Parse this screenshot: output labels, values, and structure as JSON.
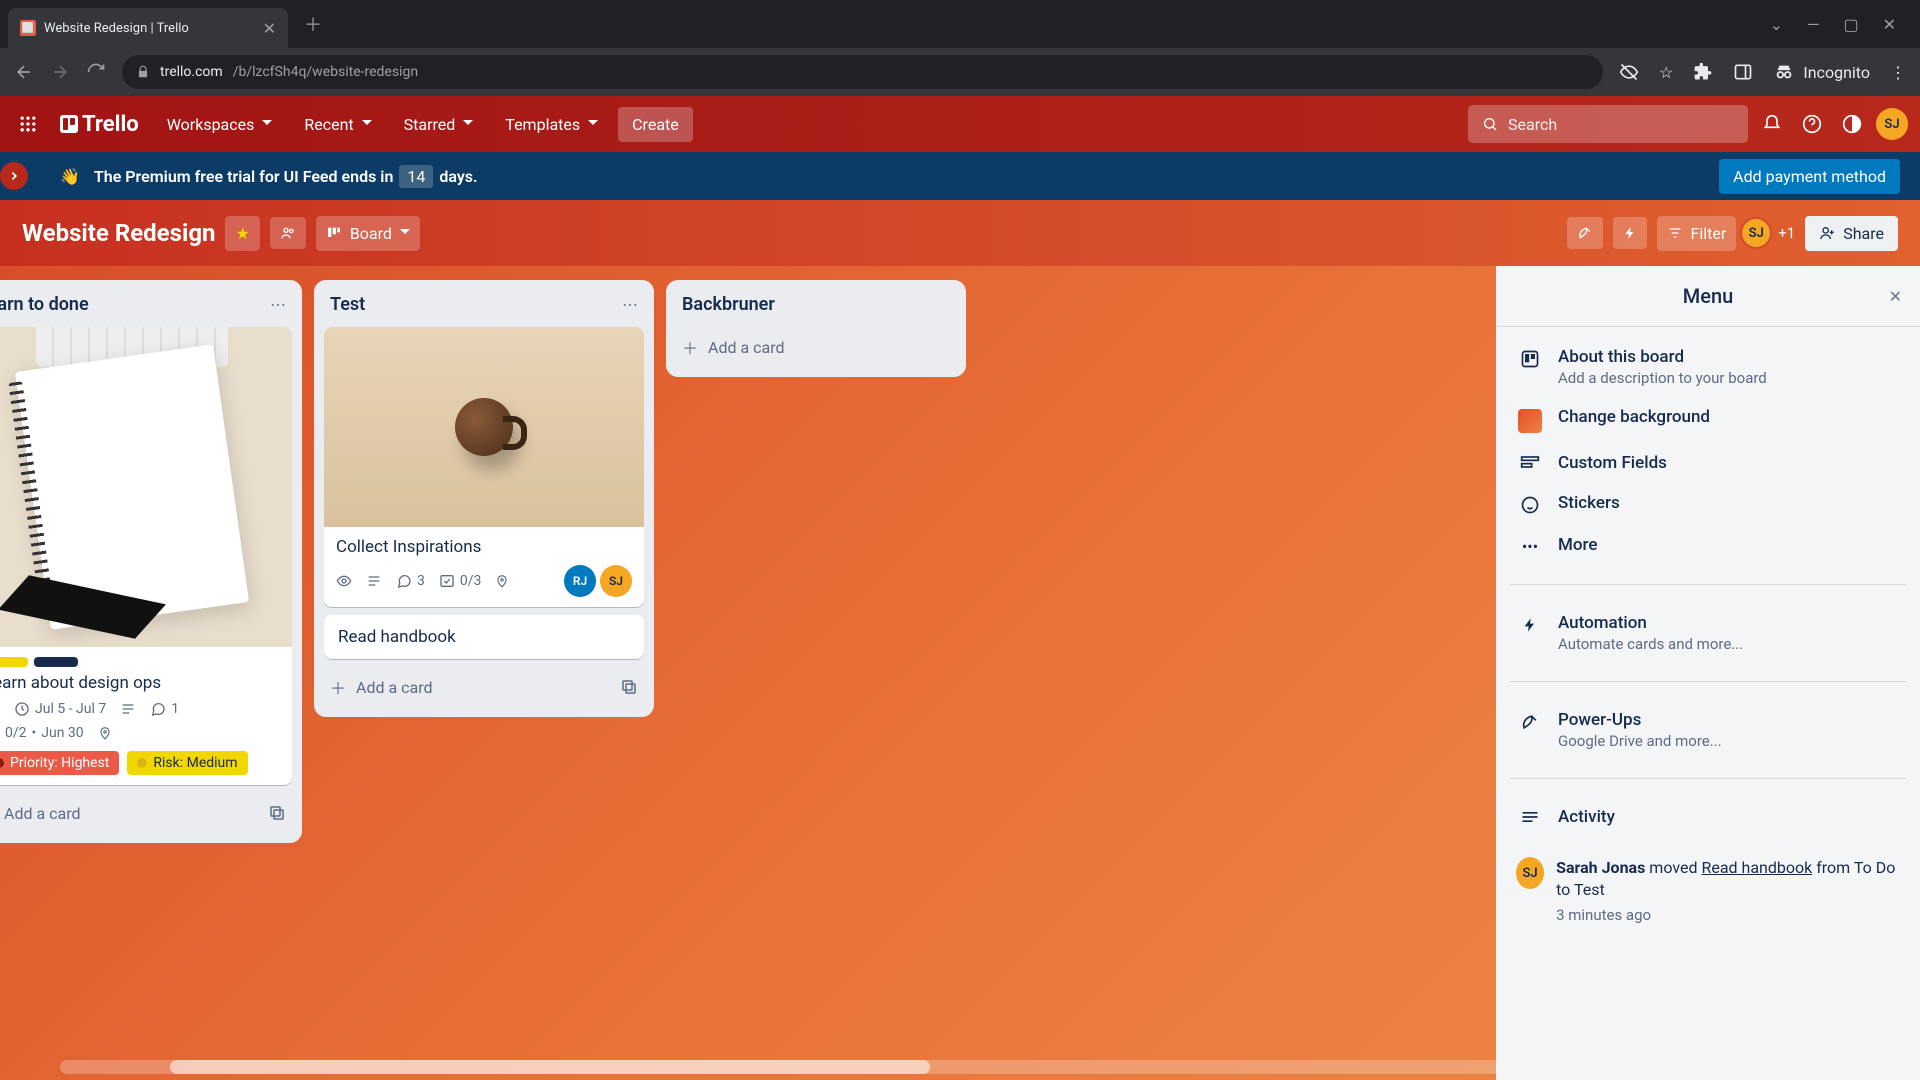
{
  "browser": {
    "tab_title": "Website Redesign | Trello",
    "url_host": "trello.com",
    "url_path": "/b/lzcfSh4q/website-redesign",
    "incognito_label": "Incognito"
  },
  "header": {
    "logo_text": "Trello",
    "nav": {
      "workspaces": "Workspaces",
      "recent": "Recent",
      "starred": "Starred",
      "templates": "Templates"
    },
    "create": "Create",
    "search_placeholder": "Search",
    "avatar_initials": "SJ"
  },
  "banner": {
    "prefix": "The Premium free trial for UI Feed ends in",
    "days": "14",
    "suffix": "days.",
    "cta": "Add payment method"
  },
  "board": {
    "title": "Website Redesign",
    "view_label": "Board",
    "filter": "Filter",
    "share": "Share",
    "plus_count": "+1",
    "member_initials": "SJ"
  },
  "lists": [
    {
      "title": "Learn to done",
      "cards": [
        {
          "title": "Learn about design ops",
          "date_range": "Jul 5 - Jul 7",
          "comments": "1",
          "checklist": "0/2",
          "due2": "Jun 30",
          "labels": [
            "#f2d600",
            "#172b4d"
          ],
          "custom_fields": [
            {
              "text": "Priority: Highest",
              "class": "red",
              "dot": "#8e1b0d"
            },
            {
              "text": "Risk: Medium",
              "class": "yellow",
              "dot": "#d9b51c"
            }
          ]
        }
      ],
      "add_card": "Add a card"
    },
    {
      "title": "Test",
      "cards": [
        {
          "title": "Collect Inspirations",
          "comments": "3",
          "checklist": "0/3",
          "members": [
            "RJ",
            "SJ"
          ]
        },
        {
          "title": "Read handbook"
        }
      ],
      "add_card": "Add a card"
    },
    {
      "title": "Backbruner",
      "cards": [],
      "add_card": "Add a card"
    }
  ],
  "menu": {
    "title": "Menu",
    "about": {
      "label": "About this board",
      "sub": "Add a description to your board"
    },
    "change_bg": "Change background",
    "custom_fields": "Custom Fields",
    "stickers": "Stickers",
    "more": "More",
    "automation": {
      "label": "Automation",
      "sub": "Automate cards and more..."
    },
    "powerups": {
      "label": "Power-Ups",
      "sub": "Google Drive and more..."
    },
    "activity": "Activity",
    "activity_item": {
      "avatar": "SJ",
      "user": "Sarah Jonas",
      "verb": " moved ",
      "object": "Read handbook",
      "rest": " from To Do to Test",
      "time": "3 minutes ago"
    }
  }
}
